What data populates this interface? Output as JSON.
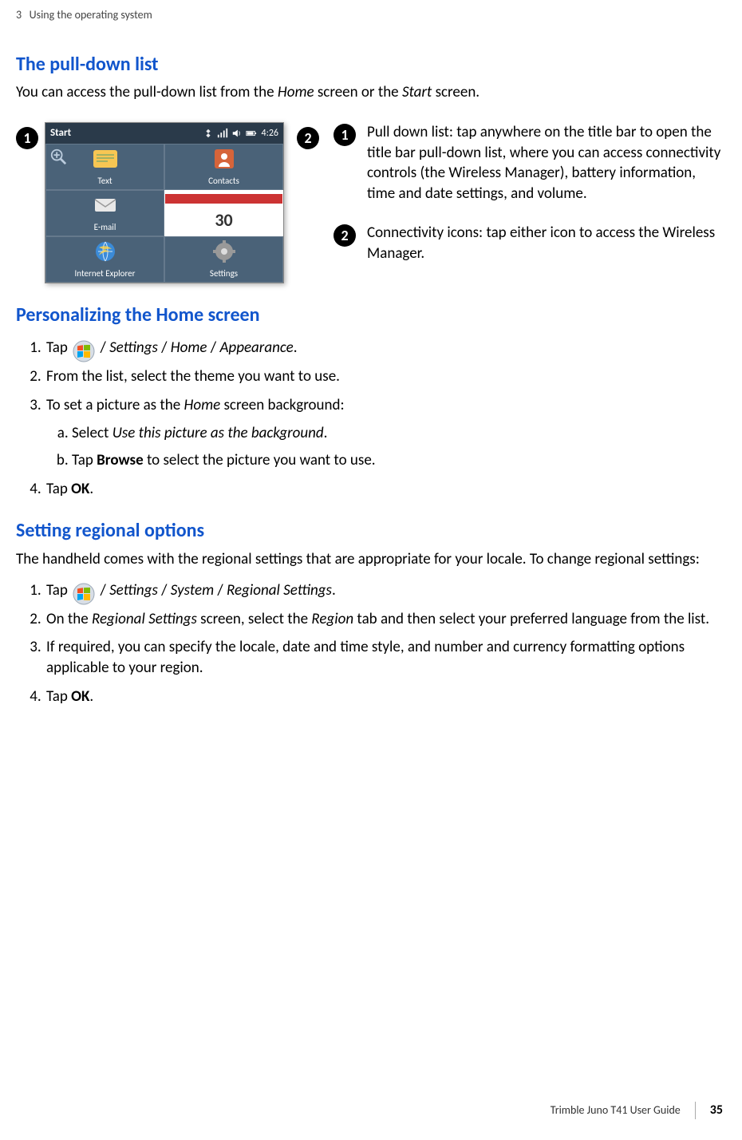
{
  "header": {
    "chapter_num": "3",
    "chapter_title": "Using the  operating system"
  },
  "sections": {
    "pulldown": {
      "title": "The pull-down list",
      "intro_a": "You can access the pull-down list from the ",
      "intro_home": "Home",
      "intro_b": " screen or the ",
      "intro_start": "Start",
      "intro_c": " screen.",
      "callout1": "Pull down list: tap anywhere on the title bar to open the title bar pull-down list, where you can access connectivity controls (the Wireless Manager), battery information, time and date settings, and volume.",
      "callout2": "Connectivity icons: tap either icon to access the Wireless Manager."
    },
    "personalizing": {
      "title": "Personalizing the Home screen",
      "items": {
        "i1_a": "Tap ",
        "i1_b": " / ",
        "i1_settings": "Settings",
        "i1_c": " / ",
        "i1_home": "Home",
        "i1_d": " / ",
        "i1_appearance": "Appearance",
        "i1_e": ".",
        "i2": "From the list, select the theme you want to use.",
        "i3_a": "To set a picture as the ",
        "i3_home": "Home",
        "i3_b": " screen background:",
        "i3a_a": "Select ",
        "i3a_i": "Use this picture as the background",
        "i3a_b": ".",
        "i3b_a": "Tap ",
        "i3b_browse": "Browse",
        "i3b_b": " to select the picture you want to use.",
        "i4_a": "Tap ",
        "i4_ok": "OK",
        "i4_b": "."
      }
    },
    "regional": {
      "title": "Setting regional options",
      "intro": "The handheld comes with the regional settings that are appropriate for your locale. To change regional settings:",
      "items": {
        "i1_a": "Tap ",
        "i1_b": " / ",
        "i1_settings": "Settings",
        "i1_c": " / ",
        "i1_system": "System",
        "i1_d": " / ",
        "i1_regional": "Regional Settings",
        "i1_e": ".",
        "i2_a": "On the ",
        "i2_regsettings": "Regional Settings",
        "i2_b": " screen, select the ",
        "i2_region": "Region",
        "i2_c": " tab and then select your preferred language from the list.",
        "i3": "If required, you can specify the locale, date and time style, and number and currency formatting options applicable to your region.",
        "i4_a": "Tap ",
        "i4_ok": "OK",
        "i4_b": "."
      }
    }
  },
  "screenshot": {
    "title": "Start",
    "clock": "4:26",
    "tiles": [
      "Text",
      "Contacts",
      "E-mail",
      "",
      "Internet Explorer",
      "Settings"
    ]
  },
  "footer": {
    "guide": "Trimble Juno T41 User Guide",
    "page": "35"
  },
  "badges": {
    "one": "1",
    "two": "2"
  }
}
